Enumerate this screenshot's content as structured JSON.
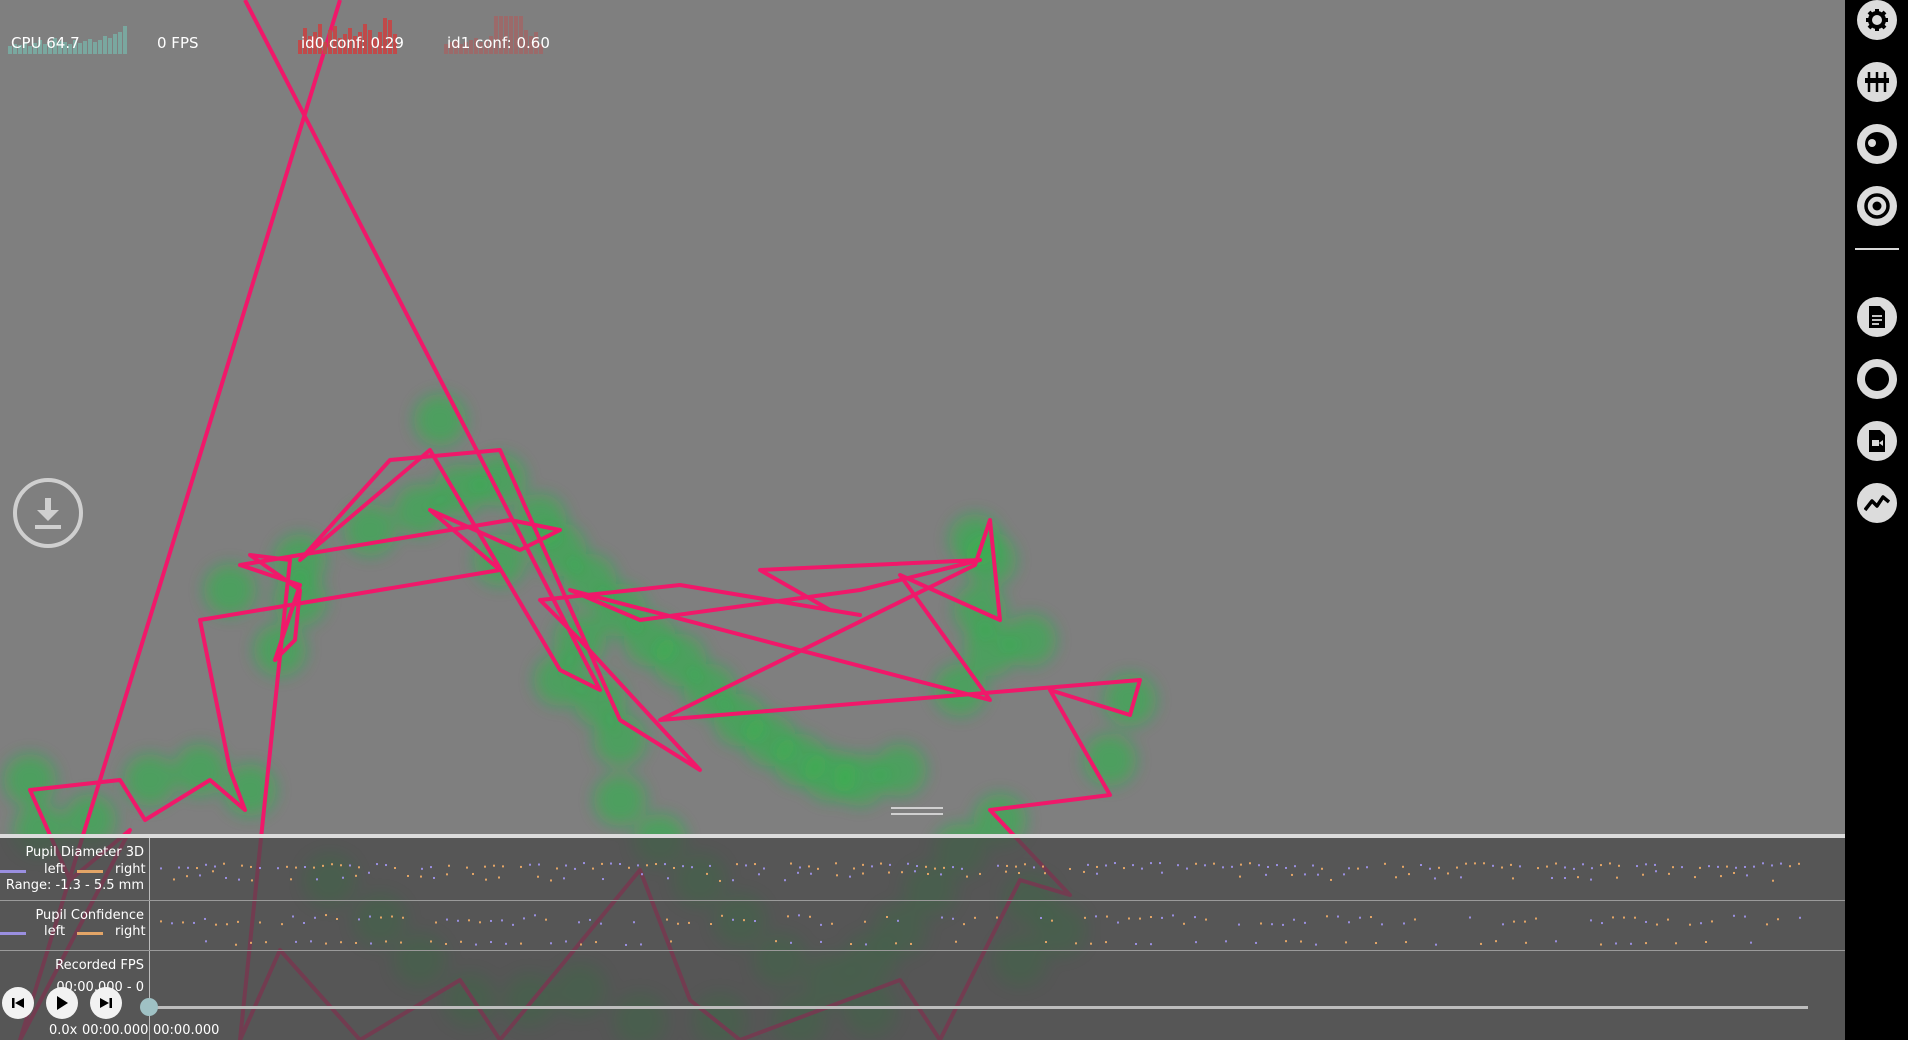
{
  "stats": {
    "cpu_label": "CPU 64.7",
    "fps_label": "0 FPS",
    "id0_label": "id0 conf: 0.29",
    "id1_label": "id1 conf: 0.60",
    "cpu_color": "#7aa79f",
    "id0_color": "#c04a4a",
    "id1_color": "#9b6a6a"
  },
  "sidebar": {
    "buttons": [
      {
        "name": "settings-gear-icon"
      },
      {
        "name": "plugin-manager-icon"
      },
      {
        "name": "eye-overlay-icon"
      },
      {
        "name": "pupil-target-icon"
      },
      {
        "name": "document-icon"
      },
      {
        "name": "record-circle-icon"
      },
      {
        "name": "video-export-icon"
      },
      {
        "name": "line-chart-icon"
      }
    ]
  },
  "timeline": {
    "row1": {
      "title": "Pupil Diameter 3D",
      "left": "left",
      "right": "right",
      "range": "Range: -1.3 - 5.5 mm"
    },
    "row2": {
      "title": "Pupil Confidence",
      "left": "left",
      "right": "right"
    },
    "row3": {
      "title": "Recorded FPS",
      "value": "00:00.000 - 0"
    },
    "legend_left_color": "#9a8fe0",
    "legend_right_color": "#e3a567"
  },
  "playback": {
    "speed": "0.0x",
    "current_time": "00:00.000",
    "start_time": "00:00.000",
    "progress": 0
  },
  "colors": {
    "gaze_line": "#f0186a",
    "fixation": "#16c43a",
    "background": "#7f7f7f"
  }
}
